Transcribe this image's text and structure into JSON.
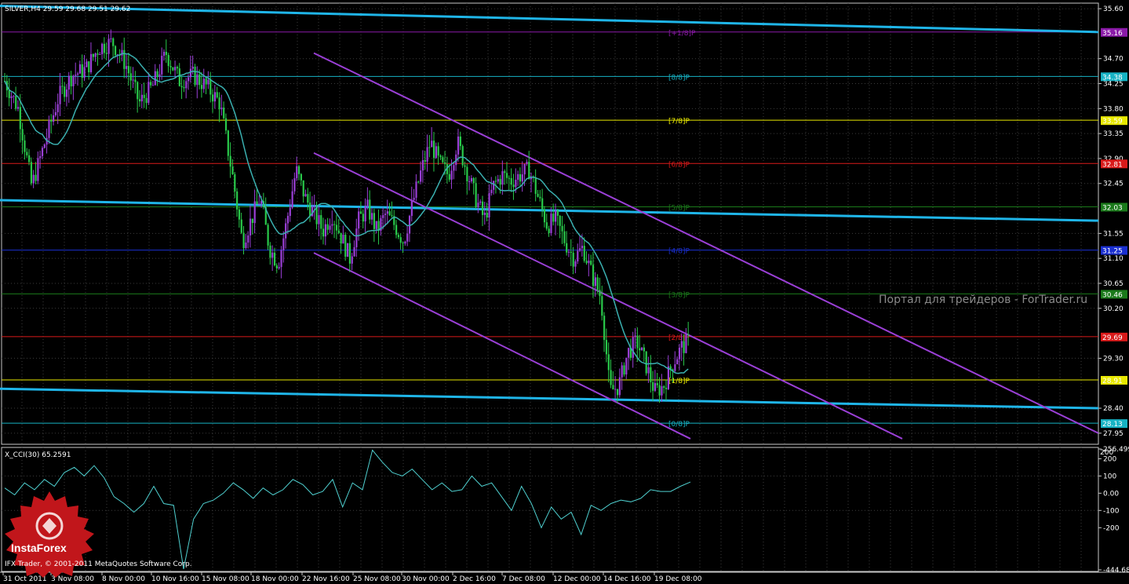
{
  "chart_data": [
    {
      "type": "candlestick",
      "symbol_line": "SILVER,H4  29.59 29.68 29.51 29.62",
      "y_range": [
        27.75,
        35.7
      ],
      "y_ticks": [
        "35.60",
        "34.70",
        "34.25",
        "33.80",
        "33.35",
        "32.90",
        "32.45",
        "31.55",
        "31.10",
        "30.65",
        "30.20",
        "29.30",
        "28.40",
        "27.95"
      ],
      "x_ticks": [
        "31 Oct 2011",
        "3 Nov 08:00",
        "8 Nov 00:00",
        "10 Nov 16:00",
        "15 Nov 08:00",
        "18 Nov 00:00",
        "22 Nov 16:00",
        "25 Nov 08:00",
        "30 Nov 00:00",
        "2 Dec 16:00",
        "7 Dec 08:00",
        "12 Dec 00:00",
        "14 Dec 16:00",
        "19 Dec 08:00"
      ],
      "bar_count": 310,
      "close_path": [
        [
          0,
          34.3
        ],
        [
          6,
          33.8
        ],
        [
          12,
          32.4
        ],
        [
          18,
          33.2
        ],
        [
          24,
          34.0
        ],
        [
          30,
          34.4
        ],
        [
          36,
          34.5
        ],
        [
          42,
          34.9
        ],
        [
          48,
          35.0
        ],
        [
          54,
          34.6
        ],
        [
          60,
          33.9
        ],
        [
          66,
          34.2
        ],
        [
          72,
          34.8
        ],
        [
          78,
          34.3
        ],
        [
          84,
          34.4
        ],
        [
          90,
          34.2
        ],
        [
          96,
          33.9
        ],
        [
          102,
          32.5
        ],
        [
          106,
          31.4
        ],
        [
          110,
          31.8
        ],
        [
          114,
          32.2
        ],
        [
          118,
          31.3
        ],
        [
          122,
          31.0
        ],
        [
          126,
          31.8
        ],
        [
          130,
          32.7
        ],
        [
          134,
          32.2
        ],
        [
          138,
          31.9
        ],
        [
          142,
          31.6
        ],
        [
          146,
          31.9
        ],
        [
          150,
          31.5
        ],
        [
          154,
          31.1
        ],
        [
          158,
          31.8
        ],
        [
          162,
          32.0
        ],
        [
          166,
          31.6
        ],
        [
          170,
          31.9
        ],
        [
          174,
          31.7
        ],
        [
          178,
          31.4
        ],
        [
          182,
          32.1
        ],
        [
          186,
          32.7
        ],
        [
          190,
          33.2
        ],
        [
          194,
          32.8
        ],
        [
          198,
          32.6
        ],
        [
          202,
          33.2
        ],
        [
          206,
          32.7
        ],
        [
          210,
          32.2
        ],
        [
          214,
          31.8
        ],
        [
          218,
          32.4
        ],
        [
          222,
          32.6
        ],
        [
          226,
          32.5
        ],
        [
          230,
          32.6
        ],
        [
          234,
          32.7
        ],
        [
          238,
          32.2
        ],
        [
          242,
          31.7
        ],
        [
          246,
          31.8
        ],
        [
          250,
          31.4
        ],
        [
          254,
          31.1
        ],
        [
          258,
          31.3
        ],
        [
          262,
          30.8
        ],
        [
          266,
          30.4
        ],
        [
          268,
          29.6
        ],
        [
          270,
          28.7
        ],
        [
          274,
          28.8
        ],
        [
          278,
          29.4
        ],
        [
          282,
          29.6
        ],
        [
          286,
          29.2
        ],
        [
          290,
          28.7
        ],
        [
          294,
          28.8
        ],
        [
          298,
          29.2
        ],
        [
          302,
          29.5
        ],
        [
          306,
          29.62
        ]
      ],
      "ma_color": "#3ab0b0",
      "bull_color": "#9a3fd6",
      "bear_color": "#29c94a",
      "murrey_levels": [
        {
          "label": "[+1/8]P",
          "value": 35.18,
          "badge": "35.16",
          "color": "#8b1aa8"
        },
        {
          "label": "[8/8]P",
          "value": 34.38,
          "badge": "34.38",
          "color": "#17b3c4"
        },
        {
          "label": "[7/8]P",
          "value": 33.59,
          "badge": "33.59",
          "color": "#e8e800"
        },
        {
          "label": "[6/8]P",
          "value": 32.81,
          "badge": "32.81",
          "color": "#d91a1a"
        },
        {
          "label": "[5/8]P",
          "value": 32.03,
          "badge": "32.03",
          "color": "#1b7a1b"
        },
        {
          "label": "[4/8]P",
          "value": 31.25,
          "badge": "31.25",
          "color": "#1a2fd0"
        },
        {
          "label": "[3/8]P",
          "value": 30.46,
          "badge": "30.46",
          "color": "#1b7a1b"
        },
        {
          "label": "[2/8]P",
          "value": 29.69,
          "badge": "29.69",
          "color": "#d91a1a"
        },
        {
          "label": "[1/8]P",
          "value": 28.91,
          "badge": "28.91",
          "color": "#e8e800"
        },
        {
          "label": "[0/8]P",
          "value": 28.13,
          "badge": "28.13",
          "color": "#17b3c4"
        }
      ],
      "cyan_channel_color": "#1fb5e8",
      "purple_channel_color": "#9a3fd6"
    },
    {
      "type": "line",
      "title": "X_CCI(30) 65.2591",
      "y_ticks": [
        "256.499",
        "200",
        "100",
        "0.00",
        "-100",
        "-200",
        "-444.689"
      ],
      "extra_top_tick": "200",
      "series_color": "#4fd0d0",
      "values": [
        30,
        -10,
        60,
        20,
        80,
        40,
        120,
        150,
        100,
        160,
        90,
        -20,
        -60,
        -110,
        -60,
        40,
        -60,
        -70,
        -440,
        -150,
        -60,
        -40,
        0,
        60,
        20,
        -30,
        30,
        -10,
        20,
        80,
        50,
        -10,
        10,
        80,
        -80,
        60,
        20,
        250,
        180,
        120,
        100,
        140,
        80,
        20,
        60,
        10,
        20,
        100,
        40,
        60,
        -20,
        -100,
        40,
        -60,
        -200,
        -80,
        -150,
        -110,
        -240,
        -70,
        -100,
        -60,
        -40,
        -50,
        -30,
        20,
        10,
        10,
        40,
        65
      ]
    }
  ],
  "watermark": "Портал для трейдеров - ForTrader.ru",
  "copyright": "IFX Trader, © 2001-2011 MetaQuotes Software Corp.",
  "logo_text": "InstaForex",
  "logo_icon": "instaforex-logo-icon"
}
